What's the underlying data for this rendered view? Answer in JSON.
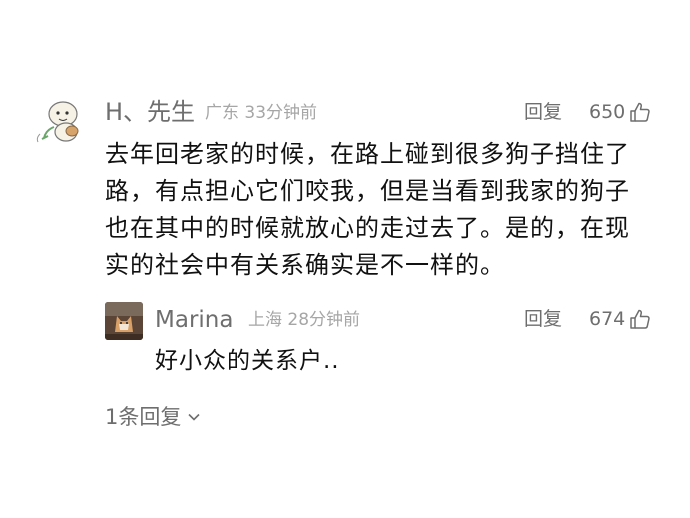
{
  "comment": {
    "username": "H、先生",
    "location": "广东",
    "time": "33分钟前",
    "reply_label": "回复",
    "like_count": "650",
    "text": "去年回老家的时候，在路上碰到很多狗子挡住了路，有点担心它们咬我，但是当看到我家的狗子也在其中的时候就放心的走过去了。是的，在现实的社会中有关系确实是不一样的。"
  },
  "reply": {
    "username": "Marina",
    "location": "上海",
    "time": "28分钟前",
    "reply_label": "回复",
    "like_count": "674",
    "text": "好小众的关系户.."
  },
  "more_replies_label": "1条回复",
  "icons": {
    "like": "thumbs-up-icon",
    "expand": "chevron-down-icon"
  },
  "colors": {
    "secondary_text": "#6e6e6e",
    "meta_text": "#a6a6a6",
    "body_text": "#111111"
  }
}
